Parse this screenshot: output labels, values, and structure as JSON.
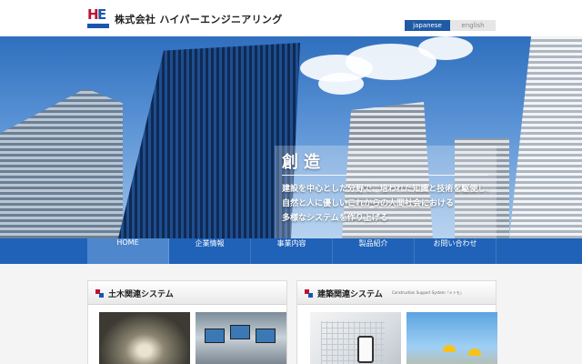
{
  "header": {
    "logo_text": "HE",
    "company_name": "株式会社 ハイパーエンジニアリング",
    "languages": [
      {
        "label": "japanese",
        "active": true
      },
      {
        "label": "english",
        "active": false
      }
    ]
  },
  "hero": {
    "title": "創造",
    "lines": [
      "建設を中心とした分野で、培われた知識と技術を駆使し、",
      "自然と人に優しいこれからの人間社会における",
      "多様なシステムを作り上げる"
    ]
  },
  "nav": {
    "items": [
      {
        "label": "HOME",
        "active": true
      },
      {
        "label": "企業情報",
        "active": false
      },
      {
        "label": "事業内容",
        "active": false
      },
      {
        "label": "製品紹介",
        "active": false
      },
      {
        "label": "お問い合わせ",
        "active": false
      }
    ]
  },
  "panels": {
    "civil": {
      "title": "土木関連システム"
    },
    "building": {
      "title": "建築関連システム",
      "subtitle": "Construction Support System「ｅトモ」"
    }
  },
  "colors": {
    "brand_blue": "#1f62b8",
    "brand_red": "#c0112e",
    "nav_active": "#4e87cc"
  }
}
